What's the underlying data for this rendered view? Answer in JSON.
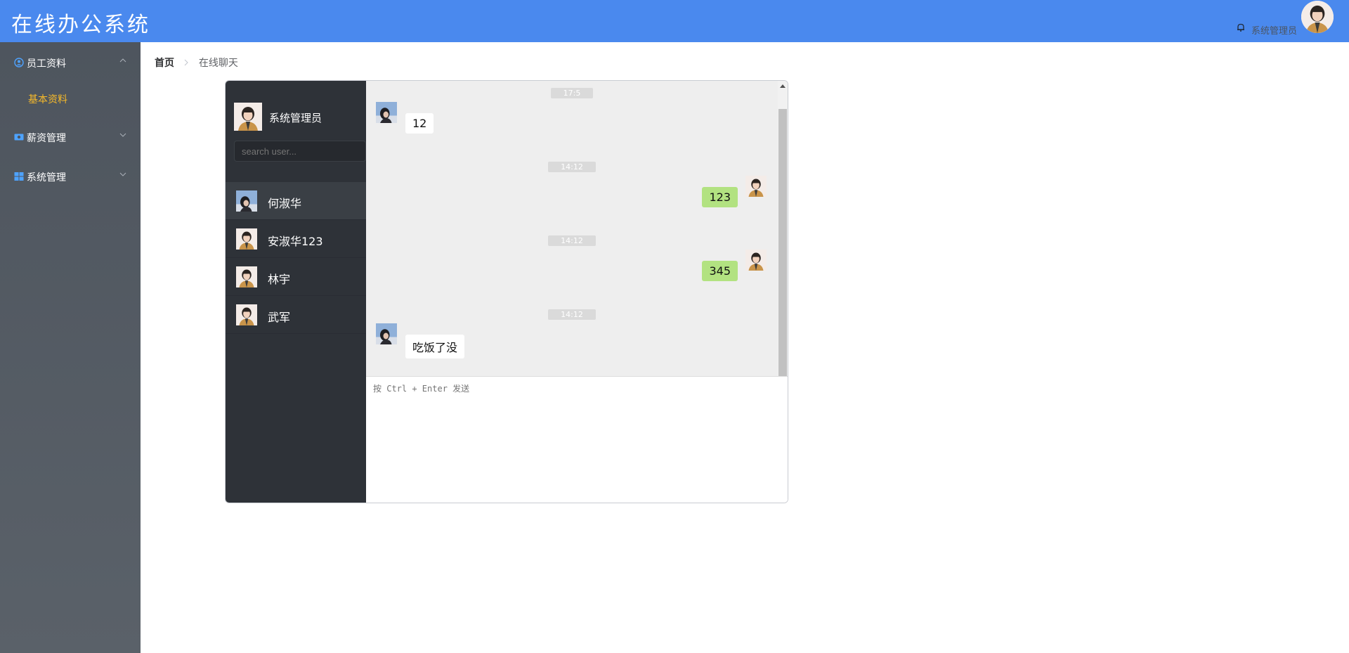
{
  "header": {
    "title": "在线办公系统",
    "user_name": "系统管理员",
    "accent": "#4a89ee"
  },
  "sidebar": {
    "items": [
      {
        "label": "员工资料",
        "icon": "user-circle-icon",
        "expanded": true,
        "children": [
          {
            "label": "基本资料",
            "active": true
          }
        ]
      },
      {
        "label": "薪资管理",
        "icon": "money-icon",
        "expanded": false
      },
      {
        "label": "系统管理",
        "icon": "windows-icon",
        "expanded": false
      }
    ]
  },
  "breadcrumb": {
    "home": "首页",
    "current": "在线聊天"
  },
  "chat": {
    "me": {
      "name": "系统管理员"
    },
    "search_placeholder": "search user...",
    "users": [
      {
        "name": "何淑华",
        "active": true
      },
      {
        "name": "安淑华123",
        "active": false
      },
      {
        "name": "林宇",
        "active": false
      },
      {
        "name": "武军",
        "active": false
      }
    ],
    "messages": [
      {
        "time": "17:5",
        "text": "12",
        "direction": "in"
      },
      {
        "time": "14:12",
        "text": "123",
        "direction": "out"
      },
      {
        "time": "14:12",
        "text": "345",
        "direction": "out"
      },
      {
        "time": "14:12",
        "text": "吃饭了没",
        "direction": "in"
      }
    ],
    "composer_placeholder": "按 Ctrl + Enter 发送"
  }
}
